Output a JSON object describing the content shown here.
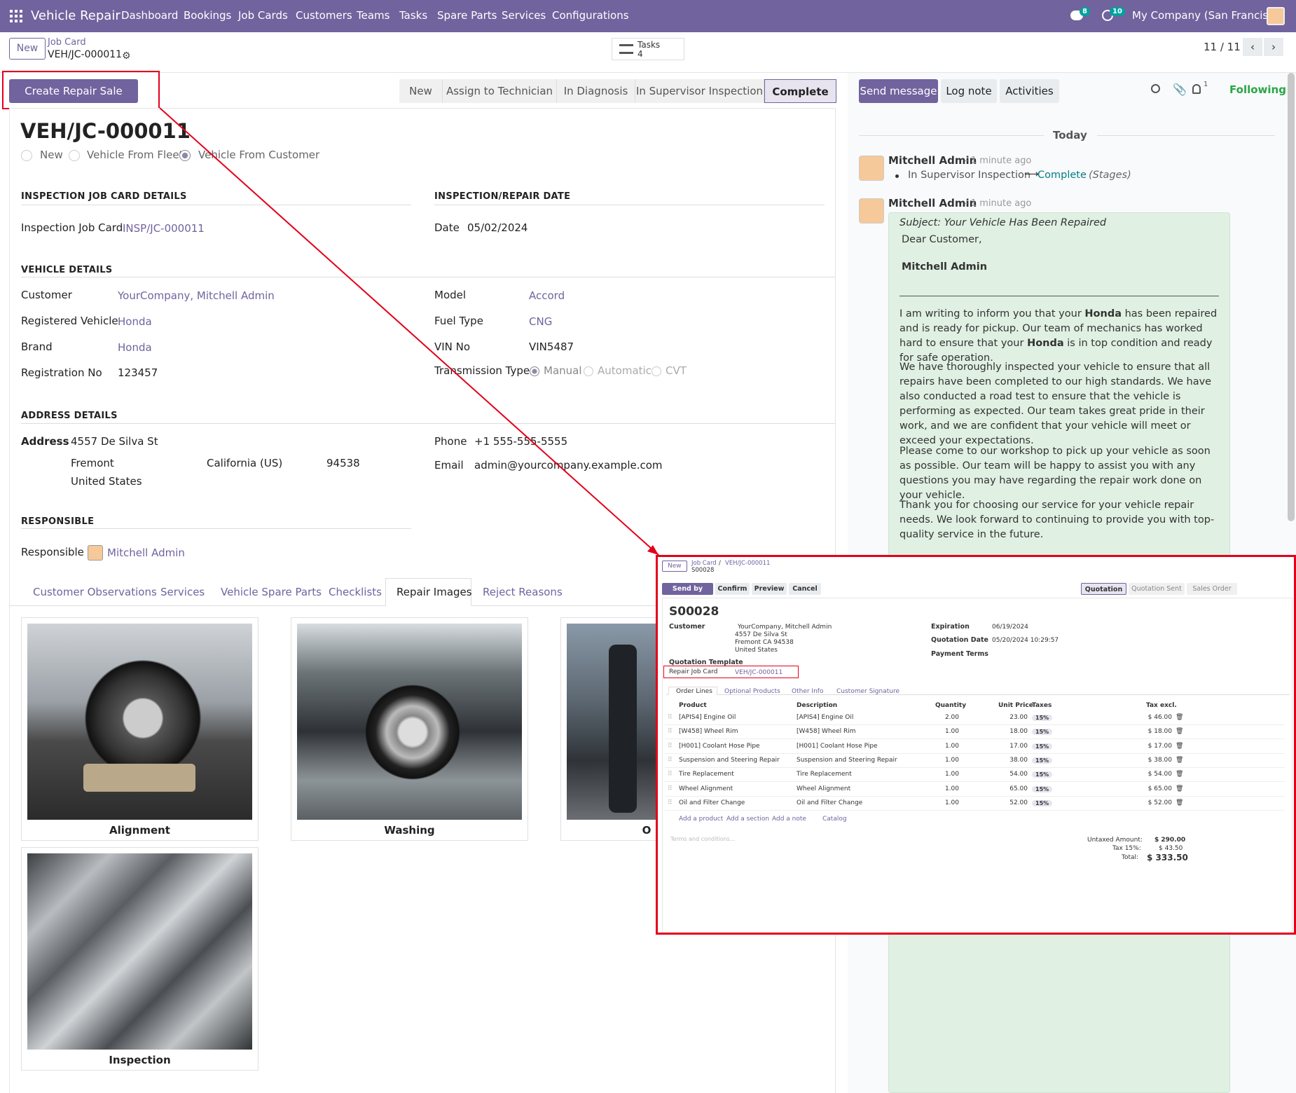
{
  "topbar": {
    "app": "Vehicle Repair",
    "menu": [
      "Dashboard",
      "Bookings",
      "Job Cards",
      "Customers",
      "Teams",
      "Tasks",
      "Spare Parts",
      "Services",
      "Configurations"
    ],
    "msg_badge": "8",
    "activity_badge": "10",
    "company": "My Company (San Francisco)"
  },
  "control": {
    "new": "New",
    "crumb": "Job Card",
    "record": "VEH/JC-000011",
    "tasks_label": "Tasks",
    "tasks_count": "4",
    "pager": "11 / 11"
  },
  "statusbar": {
    "action": "Create Repair Sale Order",
    "stages": [
      "New",
      "Assign to Technician",
      "In Diagnosis",
      "In Supervisor Inspection",
      "Complete"
    ],
    "active": "Complete"
  },
  "form": {
    "title": "VEH/JC-000011",
    "types": [
      "New",
      "Vehicle From Fleet",
      "Vehicle From Customer"
    ],
    "sec_insp": "INSPECTION JOB CARD DETAILS",
    "insp_label": "Inspection Job Card",
    "insp_val": "INSP/JC-000011",
    "sec_date": "INSPECTION/REPAIR DATE",
    "date_label": "Date",
    "date_val": "05/02/2024",
    "sec_vehicle": "VEHICLE DETAILS",
    "customer_label": "Customer",
    "customer_val": "YourCompany, Mitchell Admin",
    "regveh_label": "Registered Vehicle",
    "regveh_val": "Honda",
    "brand_label": "Brand",
    "brand_val": "Honda",
    "regno_label": "Registration No",
    "regno_val": "123457",
    "model_label": "Model",
    "model_val": "Accord",
    "fuel_label": "Fuel Type",
    "fuel_val": "CNG",
    "vin_label": "VIN No",
    "vin_val": "VIN5487",
    "trans_label": "Transmission Type",
    "trans_opts": [
      "Manual",
      "Automatic",
      "CVT"
    ],
    "sec_address": "ADDRESS DETAILS",
    "address_label": "Address",
    "street": "4557 De Silva St",
    "city": "Fremont",
    "state": "California (US)",
    "zip": "94538",
    "country": "United States",
    "phone_label": "Phone",
    "phone_val": "+1 555-555-5555",
    "email_label": "Email",
    "email_val": "admin@yourcompany.example.com",
    "sec_resp": "RESPONSIBLE",
    "resp_label": "Responsible",
    "resp_val": "Mitchell Admin",
    "tabs": [
      "Customer Observations",
      "Services",
      "Vehicle Spare Parts",
      "Checklists",
      "Repair Images",
      "Reject Reasons"
    ],
    "active_tab": "Repair Images",
    "images": [
      "Alignment",
      "Washing",
      "O",
      "Inspection"
    ]
  },
  "chatter": {
    "send": "Send message",
    "log": "Log note",
    "activities": "Activities",
    "followers": "1",
    "following": "Following",
    "today": "Today",
    "author": "Mitchell Admin",
    "time": "- 1 minute ago",
    "track_from": "In Supervisor Inspection",
    "track_arrow": "⟶",
    "track_to": "Complete",
    "track_field": "(Stages)",
    "subject": "Subject: Your Vehicle Has Been Repaired",
    "greeting": "Dear Customer,",
    "signature": "Mitchell Admin",
    "p1_a": "I am writing to inform you that your ",
    "p1_b": "Honda",
    "p1_c": " has been repaired and is ready for pickup. Our team of mechanics has worked hard to ensure that your ",
    "p1_d": "Honda",
    "p1_e": " is in top condition and ready for safe operation.",
    "p2": "We have thoroughly inspected your vehicle to ensure that all repairs have been completed to our high standards. We have also conducted a road test to ensure that the vehicle is performing as expected. Our team takes great pride in their work, and we are confident that your vehicle will meet or exceed your expectations.",
    "p3": "Please come to our workshop to pick up your vehicle as soon as possible. Our team will be happy to assist you with any questions you may have regarding the repair work done on your vehicle.",
    "p4": "Thank you for choosing our service for your vehicle repair needs. We look forward to continuing to provide you with top-quality service in the future."
  },
  "quotation": {
    "new": "New",
    "crumb1": "Job Card",
    "crumb_sep": "/",
    "crumb2": "VEH/JC-000011",
    "record": "S00028",
    "buttons": [
      "Send by Email",
      "Confirm",
      "Preview",
      "Cancel"
    ],
    "stages": [
      "Quotation",
      "Quotation Sent",
      "Sales Order"
    ],
    "title": "S00028",
    "customer_label": "Customer",
    "customer_lines": [
      "YourCompany, Mitchell Admin",
      "4557 De Silva St",
      "Fremont CA 94538",
      "United States"
    ],
    "template_label": "Quotation Template",
    "jobcard_label": "Repair Job Card",
    "jobcard_val": "VEH/JC-000011",
    "expiration_label": "Expiration",
    "expiration_val": "06/19/2024",
    "qdate_label": "Quotation Date",
    "qdate_val": "05/20/2024 10:29:57",
    "terms_label": "Payment Terms",
    "tabs": [
      "Order Lines",
      "Optional Products",
      "Other Info",
      "Customer Signature"
    ],
    "cols": [
      "Product",
      "Description",
      "Quantity",
      "Unit Price",
      "Taxes",
      "Tax excl."
    ],
    "lines": [
      [
        "[APIS4] Engine Oil",
        "[APIS4] Engine Oil",
        "2.00",
        "23.00",
        "15%",
        "$ 46.00"
      ],
      [
        "[W458] Wheel Rim",
        "[W458] Wheel Rim",
        "1.00",
        "18.00",
        "15%",
        "$ 18.00"
      ],
      [
        "[H001] Coolant Hose Pipe",
        "[H001] Coolant Hose Pipe",
        "1.00",
        "17.00",
        "15%",
        "$ 17.00"
      ],
      [
        "Suspension and Steering Repair",
        "Suspension and Steering Repair",
        "1.00",
        "38.00",
        "15%",
        "$ 38.00"
      ],
      [
        "Tire Replacement",
        "Tire Replacement",
        "1.00",
        "54.00",
        "15%",
        "$ 54.00"
      ],
      [
        "Wheel Alignment",
        "Wheel Alignment",
        "1.00",
        "65.00",
        "15%",
        "$ 65.00"
      ],
      [
        "Oil and Filter Change",
        "Oil and Filter Change",
        "1.00",
        "52.00",
        "15%",
        "$ 52.00"
      ]
    ],
    "add": [
      "Add a product",
      "Add a section",
      "Add a note",
      "Catalog"
    ],
    "terms": "Terms and conditions...",
    "untaxed_label": "Untaxed Amount:",
    "untaxed": "$ 290.00",
    "tax_label": "Tax 15%:",
    "tax": "$ 43.50",
    "total_label": "Total:",
    "total": "$ 333.50"
  },
  "colors": {
    "brand": "#71639e",
    "annotation": "#e3001b",
    "chat_bubble": "#e0f0e3"
  }
}
